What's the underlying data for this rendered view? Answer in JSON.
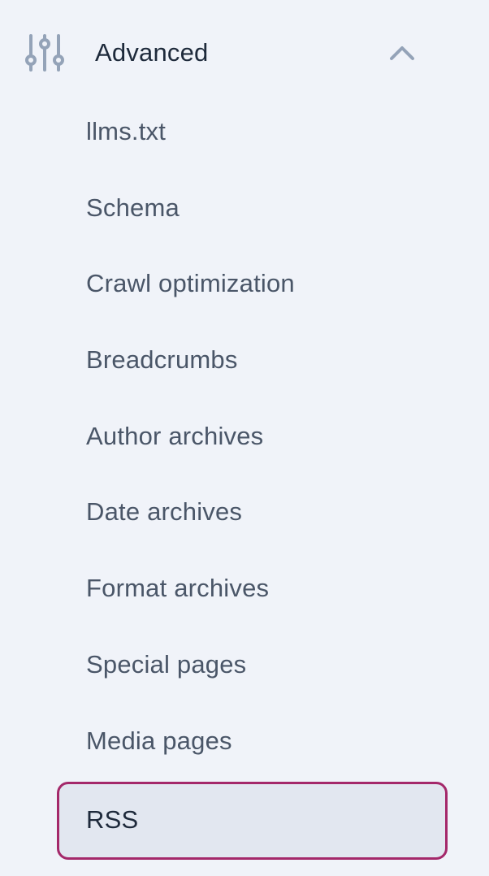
{
  "section": {
    "title": "Advanced",
    "icon": "sliders-icon",
    "expanded": true,
    "toggle_icon": "chevron-up-icon"
  },
  "submenu": {
    "items": [
      {
        "label": "llms.txt"
      },
      {
        "label": "Schema"
      },
      {
        "label": "Crawl optimization"
      },
      {
        "label": "Breadcrumbs"
      },
      {
        "label": "Author archives"
      },
      {
        "label": "Date archives"
      },
      {
        "label": "Format archives"
      },
      {
        "label": "Special pages"
      },
      {
        "label": "Media pages"
      },
      {
        "label": "RSS",
        "active": true
      }
    ]
  },
  "colors": {
    "background": "#f0f3f9",
    "active_border": "#a4286a",
    "active_background": "#e2e7f0",
    "text": "#4a5668",
    "text_strong": "#1e2a3b",
    "icon": "#94a3b8"
  }
}
